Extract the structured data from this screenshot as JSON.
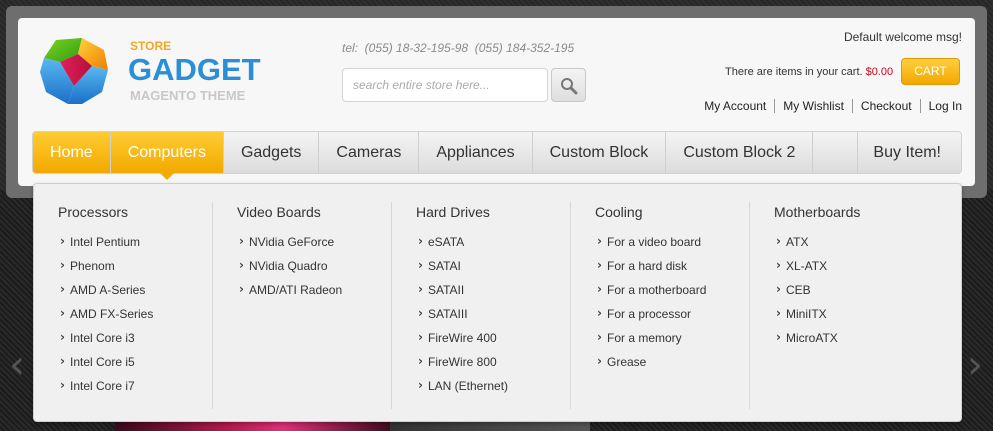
{
  "brand": {
    "store": "STORE",
    "name": "GADGET",
    "sub": "MAGENTO THEME"
  },
  "header": {
    "phone": "tel:  (055) 18-32-195-98  (055) 184-352-195",
    "search_placeholder": "search entire store here...",
    "welcome": "Default welcome msg!",
    "cart_prefix": "There are ",
    "cart_items": "items",
    "cart_suffix": " in your cart. ",
    "cart_price": "$0.00",
    "cart_button": "CART",
    "links": [
      "My Account",
      "My Wishlist",
      "Checkout",
      "Log In"
    ]
  },
  "nav": {
    "items": [
      "Home",
      "Computers",
      "Gadgets",
      "Cameras",
      "Appliances",
      "Custom Block",
      "Custom Block 2"
    ],
    "buy": "Buy Item!"
  },
  "dropdown": {
    "columns": [
      {
        "title": "Processors",
        "items": [
          "Intel Pentium",
          "Phenom",
          "AMD A-Series",
          "AMD FX-Series",
          "Intel Core i3",
          "Intel Core i5",
          "Intel Core i7"
        ]
      },
      {
        "title": "Video Boards",
        "items": [
          "NVidia GeForce",
          "NVidia Quadro",
          "AMD/ATI Radeon"
        ]
      },
      {
        "title": "Hard Drives",
        "items": [
          "eSATA",
          "SATAI",
          "SATAII",
          "SATAIII",
          "FireWire 400",
          "FireWire 800",
          "LAN (Ethernet)"
        ]
      },
      {
        "title": "Cooling",
        "items": [
          "For a video board",
          "For a hard disk",
          "For a motherboard",
          "For a processor",
          "For a memory",
          "Grease"
        ]
      },
      {
        "title": "Motherboards",
        "items": [
          "ATX",
          "XL-ATX",
          "CEB",
          "MiniITX",
          "MicroATX"
        ]
      }
    ]
  },
  "colors": {
    "accent": "#f2a900",
    "brand_blue": "#2a8fd6",
    "price_red": "#d0021b"
  }
}
